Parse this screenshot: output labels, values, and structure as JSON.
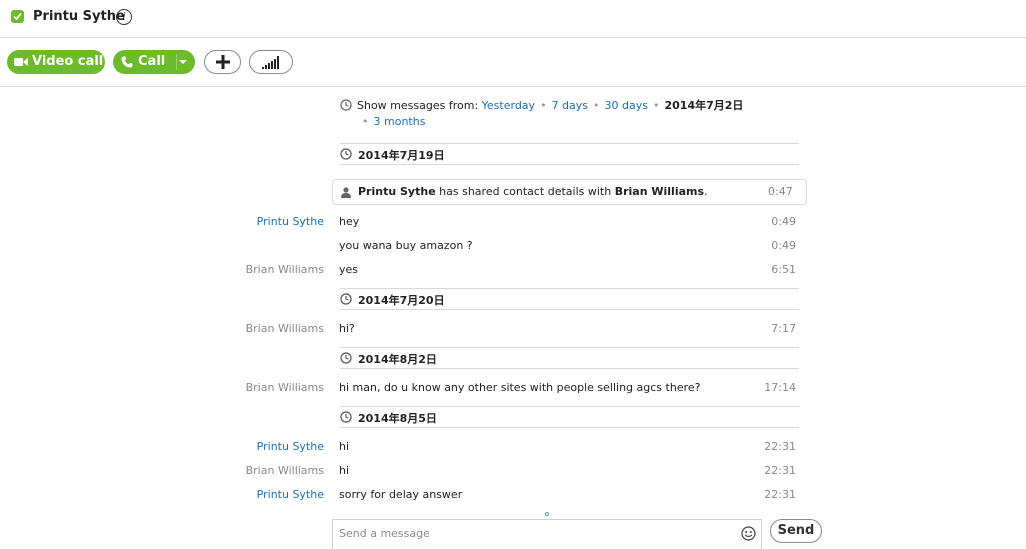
{
  "header": {
    "contact_name": "Printu Sythe",
    "status_color": "#6cbb2a",
    "status_icon": "online-check-icon",
    "mood_icon": "mood-message-icon"
  },
  "toolbar": {
    "video_call_label": "Video call",
    "call_label": "Call",
    "add_icon": "plus-icon",
    "signal_icon": "call-quality-icon",
    "accent_color": "#6cbb2a"
  },
  "history": {
    "prefix": "Show messages from:",
    "options": [
      "Yesterday",
      "7 days",
      "30 days",
      "2014年7月2日",
      "3 months"
    ],
    "link_color": "#1a6fb0"
  },
  "conversation": {
    "shared_contact": {
      "sender": "Printu Sythe",
      "middle": "has shared contact details with",
      "target": "Brian  Williams",
      "end": ".",
      "time": "0:47"
    },
    "days": [
      {
        "date": "2014年7月19日",
        "messages": [
          {
            "sender": "Printu Sythe",
            "text": "hey",
            "time": "0:49"
          },
          {
            "sender": "",
            "text": "you wana buy amazon ?",
            "time": "0:49"
          },
          {
            "sender": "Brian  Williams",
            "text": "yes",
            "time": "6:51"
          }
        ]
      },
      {
        "date": "2014年7月20日",
        "messages": [
          {
            "sender": "Brian  Williams",
            "text": "hi?",
            "time": "7:17"
          }
        ]
      },
      {
        "date": "2014年8月2日",
        "messages": [
          {
            "sender": "Brian  Williams",
            "text": "hi man, do u know any other sites with people selling agcs there?",
            "time": "17:14"
          }
        ]
      },
      {
        "date": "2014年8月5日",
        "messages": [
          {
            "sender": "Printu Sythe",
            "text": "hi",
            "time": "22:31"
          },
          {
            "sender": "Brian  Williams",
            "text": "hi",
            "time": "22:31"
          },
          {
            "sender": "Printu Sythe",
            "text": "sorry for delay answer",
            "time": "22:31"
          }
        ]
      }
    ]
  },
  "compose": {
    "placeholder": "Send a message",
    "value": "",
    "emoji_icon": "emoticon-icon",
    "send_label": "Send"
  }
}
